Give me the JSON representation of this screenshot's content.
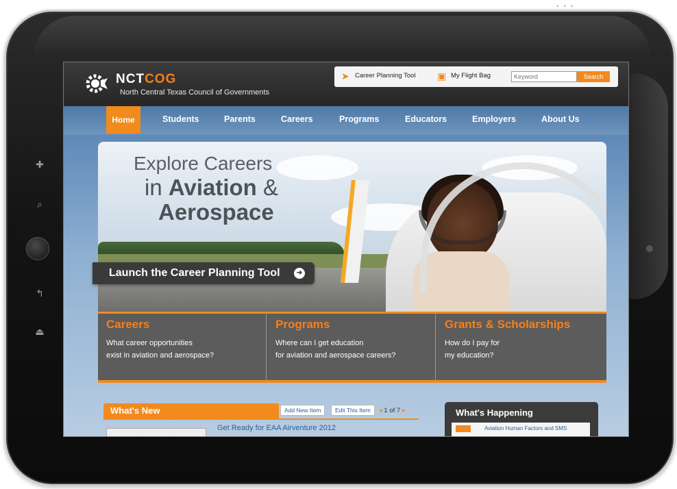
{
  "header": {
    "logo_prefix": "NCT",
    "logo_accent": "COG",
    "logo_subtitle": "North Central Texas Council of Governments",
    "career_tool_label": "Career Planning Tool",
    "flight_bag_label": "My Flight Bag",
    "search_placeholder": "Keyword",
    "search_button": "Search"
  },
  "nav": {
    "items": [
      "Home",
      "Students",
      "Parents",
      "Careers",
      "Programs",
      "Educators",
      "Employers",
      "About Us"
    ],
    "active": "Home"
  },
  "hero": {
    "line1": "Explore Careers",
    "line2_prefix": "in ",
    "line2_bold": "Aviation",
    "line2_suffix": " &",
    "line3": "Aerospace",
    "launch_button": "Launch the Career Planning Tool"
  },
  "features": [
    {
      "title": "Careers",
      "desc": "What career opportunities\nexist in aviation and aerospace?"
    },
    {
      "title": "Programs",
      "desc": "Where can I get education\nfor aviation and aerospace careers?"
    },
    {
      "title": "Grants & Scholarships",
      "desc": "How do I pay for\nmy education?"
    }
  ],
  "whats_new": {
    "title": "What's New",
    "add_button": "Add New Item",
    "edit_button": "Edit This Item",
    "pager": "1 of 7",
    "item_title": "Get Ready for EAA Airventure 2012"
  },
  "whats_happening": {
    "title": "What's Happening",
    "item": "Aviation Human Factors and SMS"
  },
  "colors": {
    "accent_orange": "#f28a1e",
    "nav_blue": "#5b83ad",
    "header_dark": "#2f2f2f"
  },
  "icons": [
    "gear-logo-icon",
    "paper-plane-icon",
    "flight-bag-icon",
    "arrow-right-icon",
    "pager-prev-icon",
    "pager-next-icon"
  ]
}
